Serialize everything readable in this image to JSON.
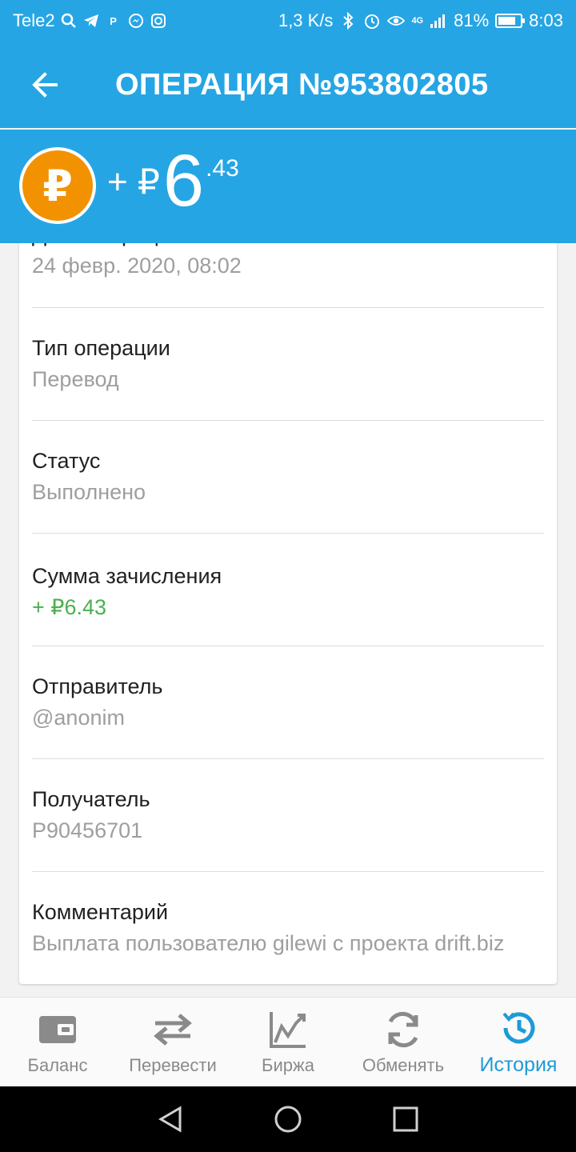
{
  "status_bar": {
    "carrier": "Tele2",
    "speed": "1,3 K/s",
    "network": "4G",
    "battery": "81%",
    "battery_level": 0.81,
    "time": "8:03"
  },
  "app_bar": {
    "title": "ОПЕРАЦИЯ №953802805"
  },
  "amount": {
    "sign": "+ ₽",
    "main": "6",
    "fraction": ".43",
    "currency_symbol": "₽"
  },
  "details": [
    {
      "label": "Дата операции",
      "value": "24 февр. 2020, 08:02"
    },
    {
      "label": "Тип операции",
      "value": "Перевод"
    },
    {
      "label": "Статус",
      "value": "Выполнено"
    },
    {
      "label": "Сумма зачисления",
      "value": "+ ₽6.43",
      "value_color": "#4caf50"
    },
    {
      "label": "Отправитель",
      "value": "@anonim"
    },
    {
      "label": "Получатель",
      "value": "P90456701"
    },
    {
      "label": "Комментарий",
      "value": "Выплата пользователю gilewi с проекта drift.biz"
    }
  ],
  "bottom_nav": [
    {
      "label": "Баланс",
      "icon": "wallet-icon"
    },
    {
      "label": "Перевести",
      "icon": "transfer-icon"
    },
    {
      "label": "Биржа",
      "icon": "chart-icon"
    },
    {
      "label": "Обменять",
      "icon": "exchange-icon"
    },
    {
      "label": "История",
      "icon": "history-icon",
      "active": true
    }
  ],
  "colors": {
    "primary": "#26a5e4",
    "coin": "#f39200",
    "accent": "#1e9ad6",
    "success": "#4caf50"
  }
}
